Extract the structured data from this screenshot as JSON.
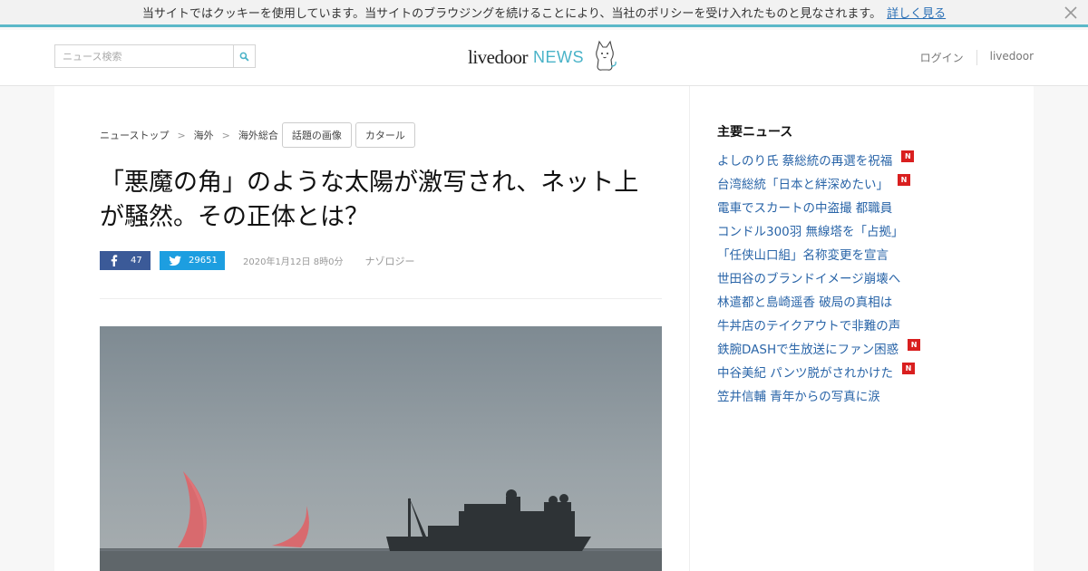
{
  "cookie_bar": {
    "message": "当サイトではクッキーを使用しています。当サイトのブラウジングを続けることにより、当社のポリシーを受け入れたものと見なされます。",
    "link": "詳しく見る"
  },
  "header": {
    "search_placeholder": "ニュース検索",
    "logo_main": "livedoor",
    "logo_sub": "NEWS",
    "login": "ログイン",
    "livedoor": "livedoor"
  },
  "breadcrumb": {
    "items": [
      "ニューストップ",
      "海外",
      "海外総合"
    ],
    "tags": [
      "話題の画像",
      "カタール"
    ]
  },
  "article": {
    "title": "「悪魔の角」のような太陽が激写され、ネット上が騒然。その正体とは？",
    "fb_count": "47",
    "tw_count": "29651",
    "date": "2020年1月12日 8時0分",
    "source": "ナゾロジー"
  },
  "sidebar": {
    "title": "主要ニュース",
    "items": [
      {
        "label": "よしのり氏 蔡総統の再選を祝福",
        "new": true
      },
      {
        "label": "台湾総統「日本と絆深めたい」",
        "new": true
      },
      {
        "label": "電車でスカートの中盗撮 都職員",
        "new": false
      },
      {
        "label": "コンドル300羽 無線塔を「占拠」",
        "new": false
      },
      {
        "label": "「任侠山口組」名称変更を宣言",
        "new": false
      },
      {
        "label": "世田谷のブランドイメージ崩壊へ",
        "new": false
      },
      {
        "label": "林遣都と島崎遥香 破局の真相は",
        "new": false
      },
      {
        "label": "牛丼店のテイクアウトで非難の声",
        "new": false
      },
      {
        "label": "鉄腕DASHで生放送にファン困惑",
        "new": true
      },
      {
        "label": "中谷美紀 パンツ脱がされかけた",
        "new": true
      },
      {
        "label": "笠井信輔 青年からの写真に涙",
        "new": false
      }
    ],
    "badge_text": "N"
  },
  "colors": {
    "accent": "#4ab3c8",
    "facebook": "#3b5a98",
    "twitter": "#1d9ee0",
    "link": "#2a65a8",
    "new_badge": "#d91f1f"
  }
}
